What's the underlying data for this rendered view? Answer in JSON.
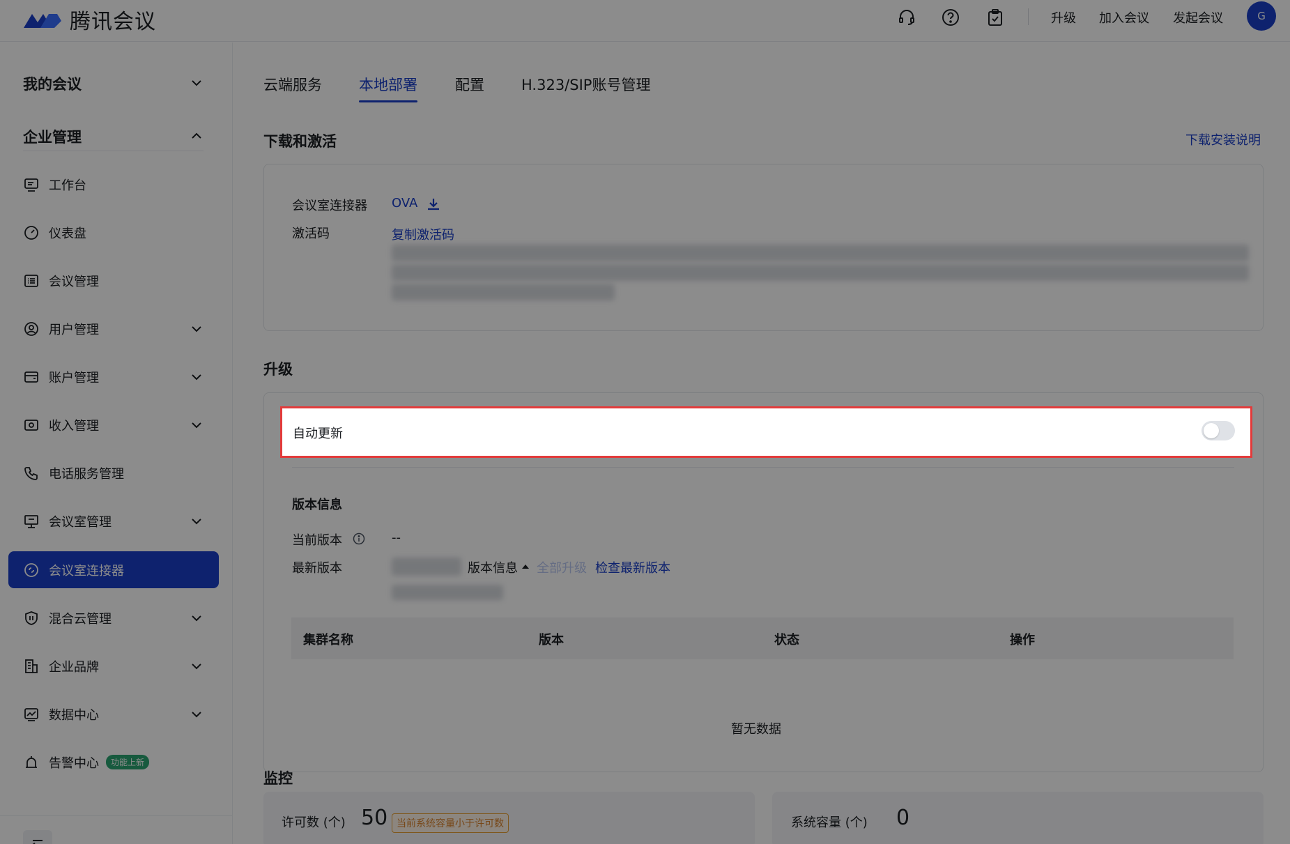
{
  "header": {
    "app_name": "腾讯会议",
    "icons": [
      "headset-icon",
      "help-icon",
      "clipboard-check-icon"
    ],
    "links": [
      "升级",
      "加入会议",
      "发起会议"
    ],
    "avatar_letter": "G"
  },
  "sidebar": {
    "group_my": "我的会议",
    "group_enterprise": "企业管理",
    "items": [
      {
        "label": "工作台",
        "icon": "desktop-icon",
        "expandable": false
      },
      {
        "label": "仪表盘",
        "icon": "gauge-icon",
        "expandable": false
      },
      {
        "label": "会议管理",
        "icon": "list-icon",
        "expandable": false
      },
      {
        "label": "用户管理",
        "icon": "user-circle-icon",
        "expandable": true
      },
      {
        "label": "账户管理",
        "icon": "wallet-icon",
        "expandable": true
      },
      {
        "label": "收入管理",
        "icon": "income-icon",
        "expandable": true
      },
      {
        "label": "电话服务管理",
        "icon": "phone-icon",
        "expandable": false
      },
      {
        "label": "会议室管理",
        "icon": "room-icon",
        "expandable": true
      },
      {
        "label": "会议室连接器",
        "icon": "connector-icon",
        "expandable": false,
        "active": true
      },
      {
        "label": "混合云管理",
        "icon": "hybrid-cloud-icon",
        "expandable": true
      },
      {
        "label": "企业品牌",
        "icon": "building-icon",
        "expandable": true
      },
      {
        "label": "数据中心",
        "icon": "chart-icon",
        "expandable": true
      },
      {
        "label": "告警中心",
        "icon": "alarm-icon",
        "expandable": false,
        "badge": "功能上新"
      }
    ]
  },
  "tabs": [
    "云端服务",
    "本地部署",
    "配置",
    "H.323/SIP账号管理"
  ],
  "active_tab": "本地部署",
  "download": {
    "title": "下载和激活",
    "guide_link": "下载安装说明",
    "connector_label": "会议室连接器",
    "connector_value": "OVA",
    "activation_label": "激活码",
    "copy_link": "复制激活码"
  },
  "upgrade": {
    "title": "升级",
    "auto_update_label": "自动更新",
    "auto_update_on": false,
    "version_info_title": "版本信息",
    "current_version_label": "当前版本",
    "current_version_value": "--",
    "latest_version_label": "最新版本",
    "version_info_toggle": "版本信息",
    "upgrade_all": "全部升级",
    "check_latest": "检查最新版本",
    "table_headers": [
      "集群名称",
      "版本",
      "状态",
      "操作"
    ],
    "empty_text": "暂无数据"
  },
  "monitor": {
    "title": "监控",
    "license_label": "许可数 (个)",
    "license_value": "50",
    "license_warning": "当前系统容量小于许可数",
    "capacity_label": "系统容量 (个)",
    "capacity_value": "0"
  },
  "colors": {
    "brand": "#1a3fc8",
    "highlight_border": "#e23b3b",
    "badge_green": "#2ba471",
    "warning": "#d9822b"
  }
}
